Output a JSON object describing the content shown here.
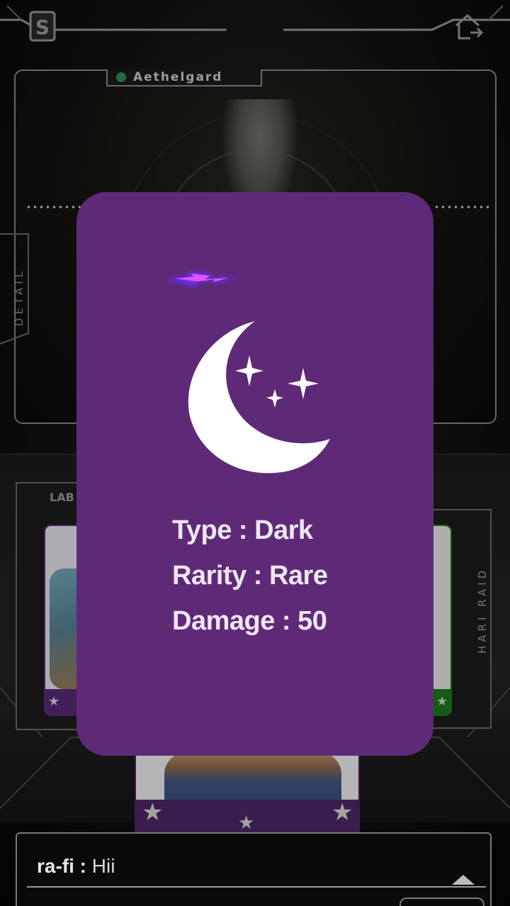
{
  "header": {
    "logo_icon": "s-logo-icon",
    "exit_icon": "home-exit-icon"
  },
  "hero": {
    "server_name": "Aethelgard",
    "server_status_color": "#2f8f4e",
    "side_label": "DETAIL"
  },
  "lower": {
    "left_label": "LAB",
    "right_label": "HARI RAID"
  },
  "card": {
    "background": "#5e2a78",
    "type_icon": "crescent-moon-stars-icon",
    "effect_icon": "purple-lightning-icon",
    "stats": [
      "Type : Dark",
      "Rarity : Rare",
      "Damage : 50"
    ]
  },
  "chat": {
    "user": "ra-fi :",
    "message": "Hii",
    "expand_icon": "chevron-up-icon"
  }
}
